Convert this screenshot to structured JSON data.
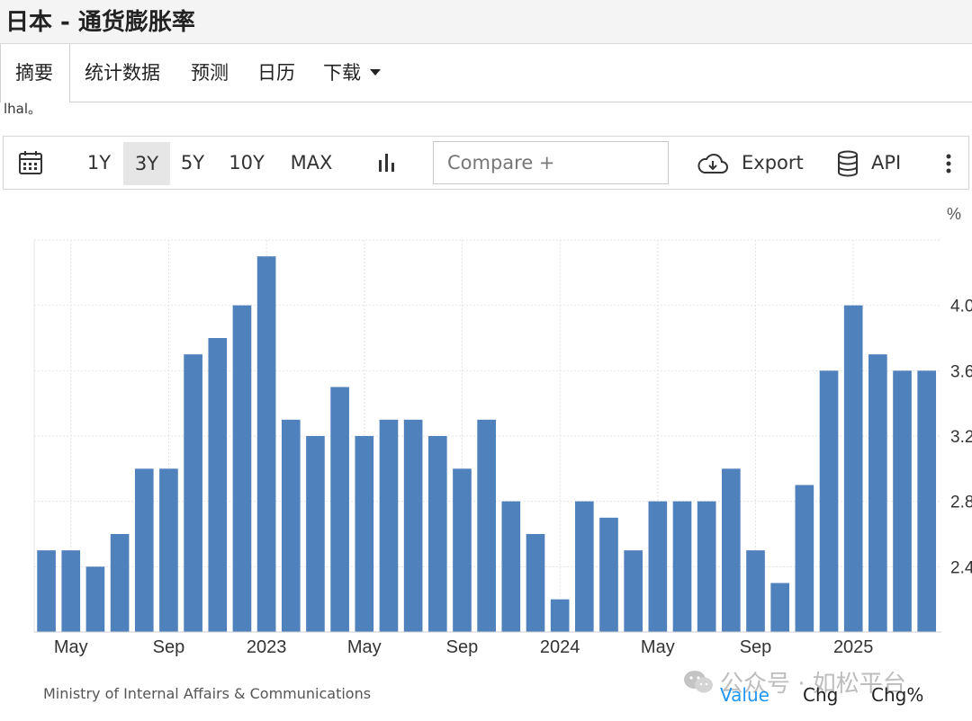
{
  "page": {
    "title": "日本 - 通货膨胀率"
  },
  "tabs": [
    {
      "label": "摘要",
      "active": true
    },
    {
      "label": "统计数据"
    },
    {
      "label": "预测"
    },
    {
      "label": "日历"
    },
    {
      "label": "下载"
    }
  ],
  "cropped_text": "lhal。",
  "toolbar": {
    "ranges": [
      "1Y",
      "3Y",
      "5Y",
      "10Y",
      "MAX"
    ],
    "selected_range": "3Y",
    "compare_placeholder": "Compare +",
    "export_label": "Export",
    "api_label": "API",
    "icons": [
      "calendar-icon",
      "bar-chart-icon",
      "cloud-download-icon",
      "database-icon",
      "more-vertical-icon"
    ]
  },
  "chart_data": {
    "type": "bar",
    "unit_label": "%",
    "x_tick_labels": [
      "May",
      "Sep",
      "2023",
      "May",
      "Sep",
      "2024",
      "May",
      "Sep",
      "2025"
    ],
    "categories": [
      "2022-04",
      "2022-05",
      "2022-06",
      "2022-07",
      "2022-08",
      "2022-09",
      "2022-10",
      "2022-11",
      "2022-12",
      "2023-01",
      "2023-02",
      "2023-03",
      "2023-04",
      "2023-05",
      "2023-06",
      "2023-07",
      "2023-08",
      "2023-09",
      "2023-10",
      "2023-11",
      "2023-12",
      "2024-01",
      "2024-02",
      "2024-03",
      "2024-04",
      "2024-05",
      "2024-06",
      "2024-07",
      "2024-08",
      "2024-09",
      "2024-10",
      "2024-11",
      "2024-12",
      "2025-01",
      "2025-02",
      "2025-03",
      "2025-04"
    ],
    "series": [
      {
        "values": [
          2.5,
          2.5,
          2.4,
          2.6,
          3.0,
          3.0,
          3.7,
          3.8,
          4.0,
          4.3,
          3.3,
          3.2,
          3.5,
          3.2,
          3.3,
          3.3,
          3.2,
          3.0,
          3.3,
          2.8,
          2.6,
          2.2,
          2.8,
          2.7,
          2.5,
          2.8,
          2.8,
          2.8,
          3.0,
          2.5,
          2.3,
          2.9,
          3.6,
          4.0,
          3.7,
          3.6,
          3.6
        ]
      }
    ],
    "y_ticks": [
      2.4,
      2.8,
      3.2,
      3.6,
      4.0
    ],
    "ylim": [
      2.0,
      4.4
    ],
    "grid": true,
    "bar_color": "#4f81bd"
  },
  "footer": {
    "source": "Ministry of Internal Affairs & Communications",
    "tabs": [
      "Value",
      "Chg",
      "Chg%"
    ],
    "active_tab": "Value",
    "active_color": "#2196f3"
  },
  "watermark": "公众号 · 如松平台"
}
